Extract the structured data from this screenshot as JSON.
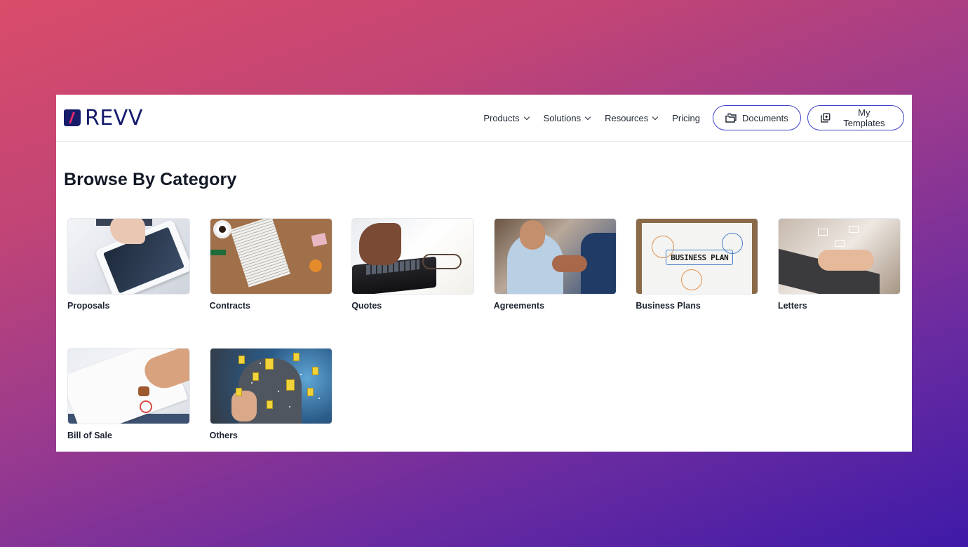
{
  "brand": {
    "name": "REVV",
    "colors": {
      "navy": "#171c6b",
      "accent_pink": "#e8296b",
      "button_border": "#3d43c7",
      "heading": "#121826"
    }
  },
  "header": {
    "nav": [
      {
        "label": "Products",
        "has_dropdown": true
      },
      {
        "label": "Solutions",
        "has_dropdown": true
      },
      {
        "label": "Resources",
        "has_dropdown": true
      },
      {
        "label": "Pricing",
        "has_dropdown": false
      }
    ],
    "buttons": [
      {
        "label": "Documents",
        "icon": "folders-icon"
      },
      {
        "label": "My Templates",
        "icon": "copy-plus-icon"
      }
    ]
  },
  "main": {
    "title": "Browse By Category",
    "categories": [
      {
        "label": "Proposals",
        "image": "tablet-with-business-proposal"
      },
      {
        "label": "Contracts",
        "image": "contract-on-desk"
      },
      {
        "label": "Quotes",
        "image": "calculator-and-glasses"
      },
      {
        "label": "Agreements",
        "image": "handshake"
      },
      {
        "label": "Business Plans",
        "image": "business-plan-whiteboard"
      },
      {
        "label": "Letters",
        "image": "laptop-typing-with-envelopes"
      },
      {
        "label": "Bill of Sale",
        "image": "document-stamp"
      },
      {
        "label": "Others",
        "image": "digital-documents"
      }
    ]
  }
}
